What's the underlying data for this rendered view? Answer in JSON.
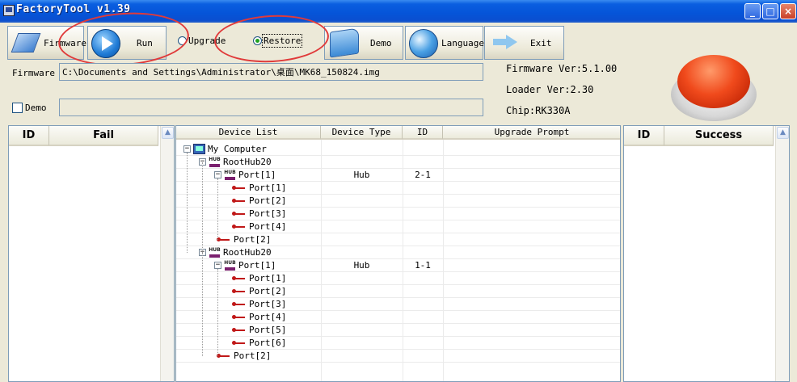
{
  "window": {
    "title": "FactoryTool v1.39"
  },
  "toolbar": {
    "firmware": "Firmware",
    "run": "Run",
    "upgrade": "Upgrade",
    "restore": "Restore",
    "demo": "Demo",
    "language": "Language",
    "exit": "Exit",
    "mode_selected": "Restore"
  },
  "firmware_path": {
    "label": "Firmware",
    "value": "C:\\Documents and Settings\\Administrator\\桌面\\MK68_150824.img"
  },
  "demo_option": {
    "label": "Demo",
    "checked": false,
    "path": ""
  },
  "info": {
    "firmware_ver": "Firmware Ver:5.1.00",
    "loader_ver": "Loader Ver:2.30",
    "chip": "Chip:RK330A"
  },
  "fail_panel": {
    "headers": [
      "ID",
      "Fail"
    ]
  },
  "success_panel": {
    "headers": [
      "ID",
      "Success"
    ]
  },
  "device_list": {
    "headers": [
      "Device List",
      "Device Type",
      "ID",
      "Upgrade Prompt"
    ],
    "rows": [
      {
        "name": "My Computer",
        "type": "",
        "id": ""
      },
      {
        "name": "RootHub20",
        "type": "",
        "id": ""
      },
      {
        "name": "Port[1]",
        "type": "Hub",
        "id": "2-1"
      },
      {
        "name": "Port[1]",
        "type": "",
        "id": ""
      },
      {
        "name": "Port[2]",
        "type": "",
        "id": ""
      },
      {
        "name": "Port[3]",
        "type": "",
        "id": ""
      },
      {
        "name": "Port[4]",
        "type": "",
        "id": ""
      },
      {
        "name": "Port[2]",
        "type": "",
        "id": ""
      },
      {
        "name": "RootHub20",
        "type": "",
        "id": ""
      },
      {
        "name": "Port[1]",
        "type": "Hub",
        "id": "1-1"
      },
      {
        "name": "Port[1]",
        "type": "",
        "id": ""
      },
      {
        "name": "Port[2]",
        "type": "",
        "id": ""
      },
      {
        "name": "Port[3]",
        "type": "",
        "id": ""
      },
      {
        "name": "Port[4]",
        "type": "",
        "id": ""
      },
      {
        "name": "Port[5]",
        "type": "",
        "id": ""
      },
      {
        "name": "Port[6]",
        "type": "",
        "id": ""
      },
      {
        "name": "Port[2]",
        "type": "",
        "id": ""
      }
    ]
  }
}
